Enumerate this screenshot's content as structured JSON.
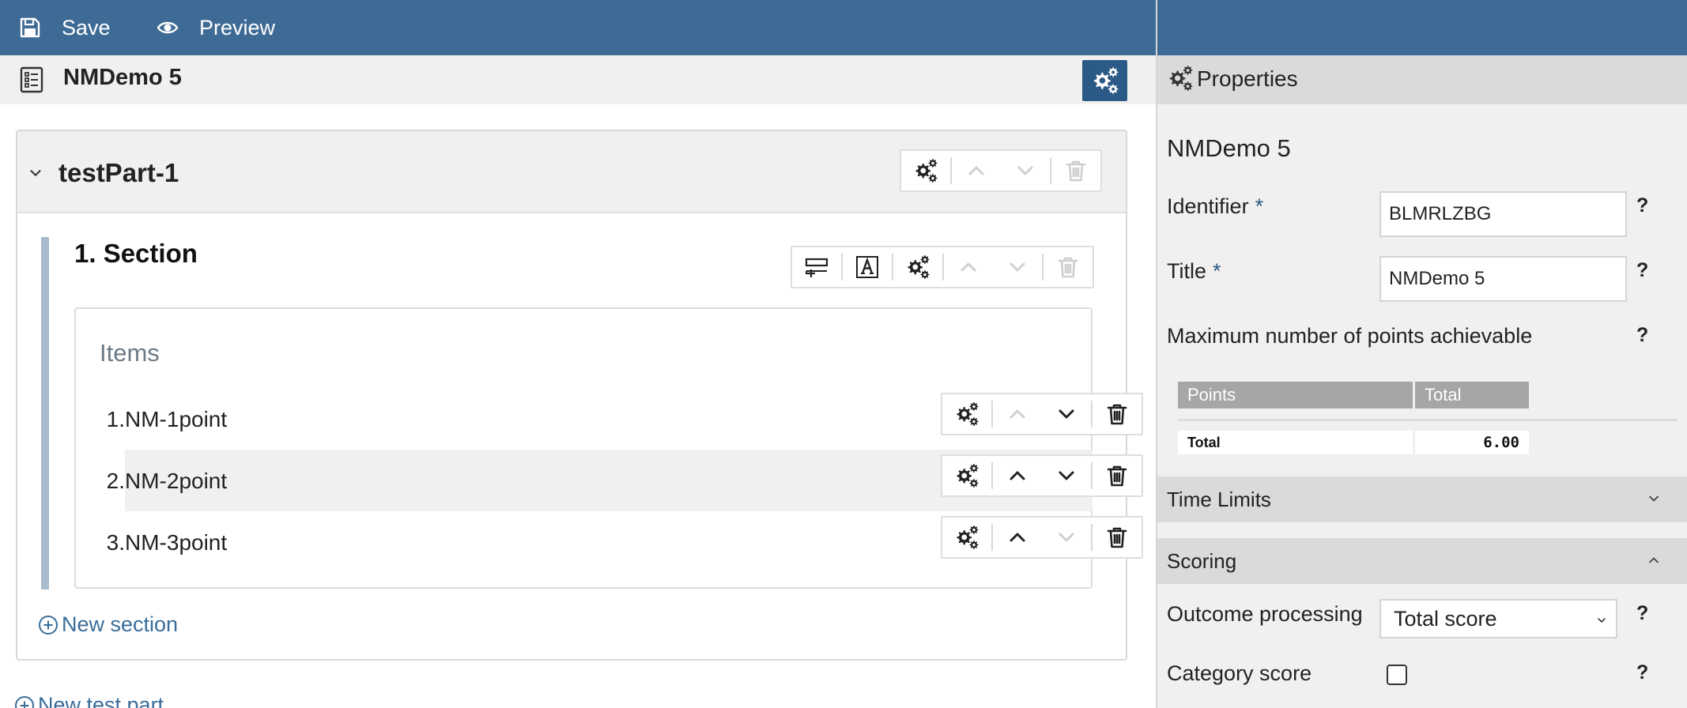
{
  "toolbar": {
    "save_label": "Save",
    "preview_label": "Preview"
  },
  "header": {
    "title": "NMDemo 5"
  },
  "test_part": {
    "title": "testPart-1"
  },
  "section": {
    "title": "1. Section",
    "items_label": "Items",
    "items": [
      {
        "num": "1.",
        "label": "NM-1point"
      },
      {
        "num": "2.",
        "label": "NM-2point"
      },
      {
        "num": "3.",
        "label": "NM-3point"
      }
    ]
  },
  "links": {
    "new_section": "New section",
    "new_test_part": "New test part"
  },
  "properties": {
    "title": "Properties",
    "name": "NMDemo 5",
    "identifier_label": "Identifier",
    "identifier_value": "BLMRLZBG",
    "title_label": "Title",
    "title_value": "NMDemo 5",
    "required_mark": "*",
    "help_mark": "?",
    "max_points_label": "Maximum number of points achievable",
    "points_table": {
      "col_points": "Points",
      "col_total": "Total",
      "total_label": "Total",
      "total_value": "6.00"
    },
    "time_limits_label": "Time Limits",
    "scoring_label": "Scoring",
    "outcome_processing_label": "Outcome processing",
    "outcome_processing_value": "Total score",
    "category_score_label": "Category score",
    "category_score_checked": false
  },
  "colors": {
    "topbar": "#3e6b96",
    "accent": "#2c5a86",
    "link": "#3a6d9a",
    "panel_bg": "#f2f0ee"
  }
}
